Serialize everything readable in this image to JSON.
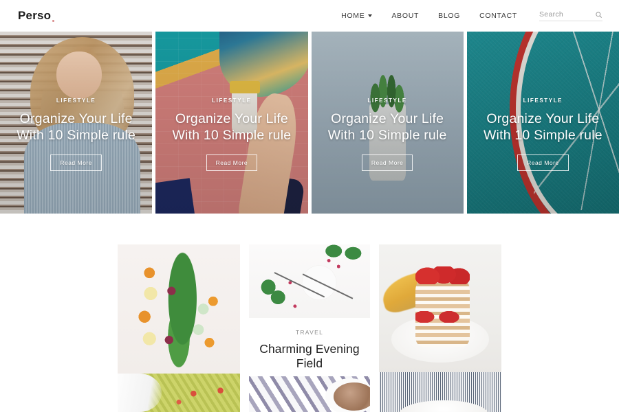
{
  "header": {
    "logo": "Perso",
    "nav": [
      {
        "label": "HOME",
        "has_dropdown": true
      },
      {
        "label": "ABOUT",
        "has_dropdown": false
      },
      {
        "label": "BLOG",
        "has_dropdown": false
      },
      {
        "label": "CONTACT",
        "has_dropdown": false
      }
    ],
    "search": {
      "placeholder": "Search",
      "value": "",
      "icon": "search-icon"
    }
  },
  "hero": {
    "cards": [
      {
        "category": "LIFESTYLE",
        "title": "Organize Your Life With 10 Simple rule",
        "button": "Read More",
        "image_alt": "blonde-woman-in-blue-sweater-against-wooden-blinds"
      },
      {
        "category": "LIFESTYLE",
        "title": "Organize Your Life With 10 Simple rule",
        "button": "Read More",
        "image_alt": "hand-holding-coffee-cup-against-pink-painted-wall"
      },
      {
        "category": "LIFESTYLE",
        "title": "Organize Your Life With 10 Simple rule",
        "button": "Read More",
        "image_alt": "succulent-plant-in-pot-against-grey-blue-wall"
      },
      {
        "category": "LIFESTYLE",
        "title": "Organize Your Life With 10 Simple rule",
        "button": "Read More",
        "image_alt": "red-bicycle-wheel-against-teal-wall"
      }
    ]
  },
  "lower": {
    "columns": [
      {
        "images": [
          "kale-carrots-lemon-cucumber-flatlay",
          "pesto-farfalle-pasta-salad-with-tomatoes"
        ]
      },
      {
        "images": [
          "white-plate-with-pinecone-fork-and-spoon",
          "striped-linen-towel-with-coffee-cup"
        ],
        "post": {
          "category": "TRAVEL",
          "title": "Charming Evening Field"
        }
      },
      {
        "images": [
          "pancake-stack-with-strawberries-and-banana",
          "striped-cloth-with-white-plate"
        ]
      }
    ]
  },
  "colors": {
    "accent": "#d88a8a",
    "text": "#1b1b1b",
    "muted": "#8d8d8d",
    "hero_teal": "#1a8186",
    "hero_pink": "#d9837f"
  }
}
